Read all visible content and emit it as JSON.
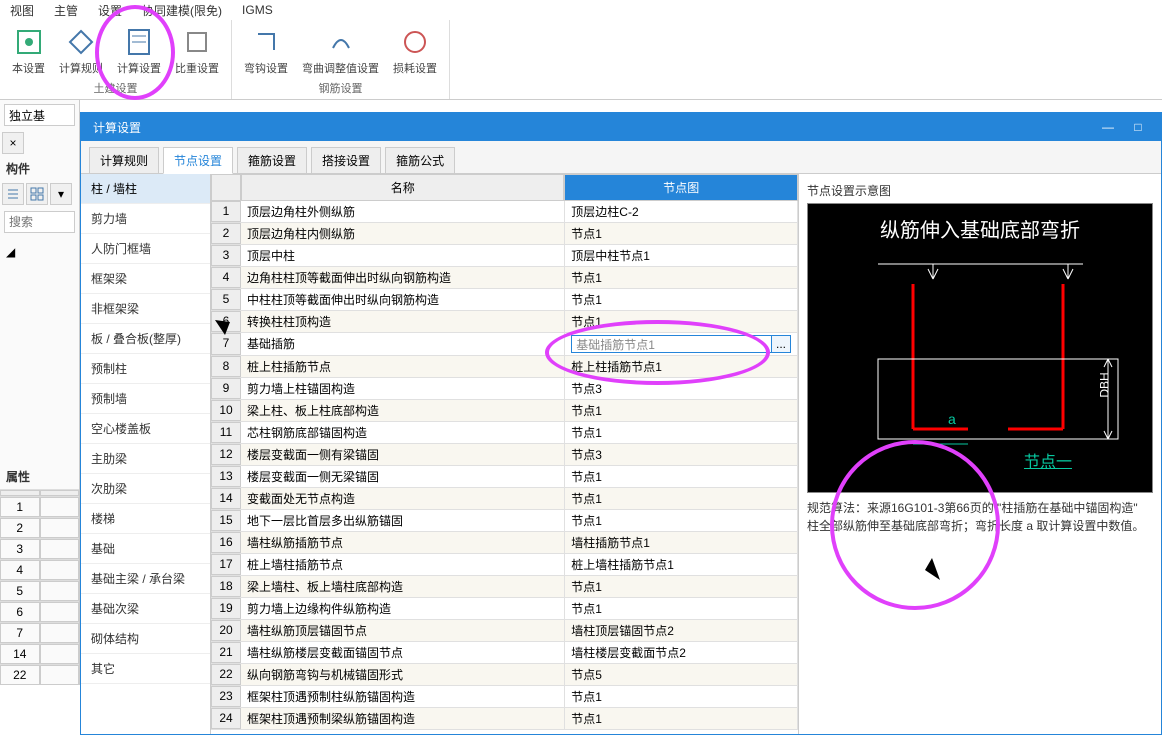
{
  "ribbon_top": [
    "",
    "视图",
    "",
    "主管",
    "",
    "设置",
    "",
    "协同建模(限免)",
    "IGMS"
  ],
  "ribbon": {
    "group1_label": "土建设置",
    "group2_label": "钢筋设置",
    "items1": [
      "本设置",
      "计算规则",
      "计算设置",
      "比重设置"
    ],
    "items2": [
      "弯钩设置",
      "弯曲调整值设置",
      "损耗设置"
    ]
  },
  "left": {
    "dropdown": "独立基",
    "gj_label": "构件",
    "search": "搜索",
    "attr_label": "属性",
    "rows": [
      "1",
      "2",
      "3",
      "4",
      "5",
      "6",
      "7",
      "14",
      "22"
    ]
  },
  "dialog": {
    "title": "计算设置",
    "tabs": [
      "计算规则",
      "节点设置",
      "箍筋设置",
      "搭接设置",
      "箍筋公式"
    ],
    "active_tab": 1
  },
  "categories": [
    "柱 / 墙柱",
    "剪力墙",
    "人防门框墙",
    "框架梁",
    "非框架梁",
    "板 / 叠合板(整厚)",
    "预制柱",
    "预制墙",
    "空心楼盖板",
    "主肋梁",
    "次肋梁",
    "楼梯",
    "基础",
    "基础主梁 / 承台梁",
    "基础次梁",
    "砌体结构",
    "其它"
  ],
  "col_name": "名称",
  "col_diag": "节点图",
  "rows": [
    {
      "n": "1",
      "name": "顶层边角柱外侧纵筋",
      "diag": "顶层边柱C-2"
    },
    {
      "n": "2",
      "name": "顶层边角柱内侧纵筋",
      "diag": "节点1"
    },
    {
      "n": "3",
      "name": "顶层中柱",
      "diag": "顶层中柱节点1"
    },
    {
      "n": "4",
      "name": "边角柱柱顶等截面伸出时纵向钢筋构造",
      "diag": "节点1"
    },
    {
      "n": "5",
      "name": "中柱柱顶等截面伸出时纵向钢筋构造",
      "diag": "节点1"
    },
    {
      "n": "6",
      "name": "转换柱柱顶构造",
      "diag": "节点1"
    },
    {
      "n": "7",
      "name": "基础插筋",
      "diag": "基础插筋节点1",
      "editing": true
    },
    {
      "n": "8",
      "name": "桩上柱插筋节点",
      "diag": "桩上柱插筋节点1"
    },
    {
      "n": "9",
      "name": "剪力墙上柱锚固构造",
      "diag": "节点3"
    },
    {
      "n": "10",
      "name": "梁上柱、板上柱底部构造",
      "diag": "节点1"
    },
    {
      "n": "11",
      "name": "芯柱钢筋底部锚固构造",
      "diag": "节点1"
    },
    {
      "n": "12",
      "name": "楼层变截面一侧有梁锚固",
      "diag": "节点3"
    },
    {
      "n": "13",
      "name": "楼层变截面一侧无梁锚固",
      "diag": "节点1"
    },
    {
      "n": "14",
      "name": "变截面处无节点构造",
      "diag": "节点1"
    },
    {
      "n": "15",
      "name": "地下一层比首层多出纵筋锚固",
      "diag": "节点1"
    },
    {
      "n": "16",
      "name": "墙柱纵筋插筋节点",
      "diag": "墙柱插筋节点1"
    },
    {
      "n": "17",
      "name": "桩上墙柱插筋节点",
      "diag": "桩上墙柱插筋节点1"
    },
    {
      "n": "18",
      "name": "梁上墙柱、板上墙柱底部构造",
      "diag": "节点1"
    },
    {
      "n": "19",
      "name": "剪力墙上边缘构件纵筋构造",
      "diag": "节点1"
    },
    {
      "n": "20",
      "name": "墙柱纵筋顶层锚固节点",
      "diag": "墙柱顶层锚固节点2"
    },
    {
      "n": "21",
      "name": "墙柱纵筋楼层变截面锚固节点",
      "diag": "墙柱楼层变截面节点2"
    },
    {
      "n": "22",
      "name": "纵向钢筋弯钩与机械锚固形式",
      "diag": "节点5"
    },
    {
      "n": "23",
      "name": "框架柱顶遇预制柱纵筋锚固构造",
      "diag": "节点1"
    },
    {
      "n": "24",
      "name": "框架柱顶遇预制梁纵筋锚固构造",
      "diag": "节点1"
    }
  ],
  "diagram": {
    "title": "节点设置示意图",
    "big_text": "纵筋伸入基础底部弯折",
    "node_label": "节点一",
    "var_a": "a",
    "dbh": "DBH",
    "desc1": "规范算法：来源16G101-3第66页的 \"柱插筋在基础中锚固构造\"",
    "desc2": "柱全部纵筋伸至基础底部弯折；弯折长度 a 取计算设置中数值。"
  },
  "ellipsis": "..."
}
